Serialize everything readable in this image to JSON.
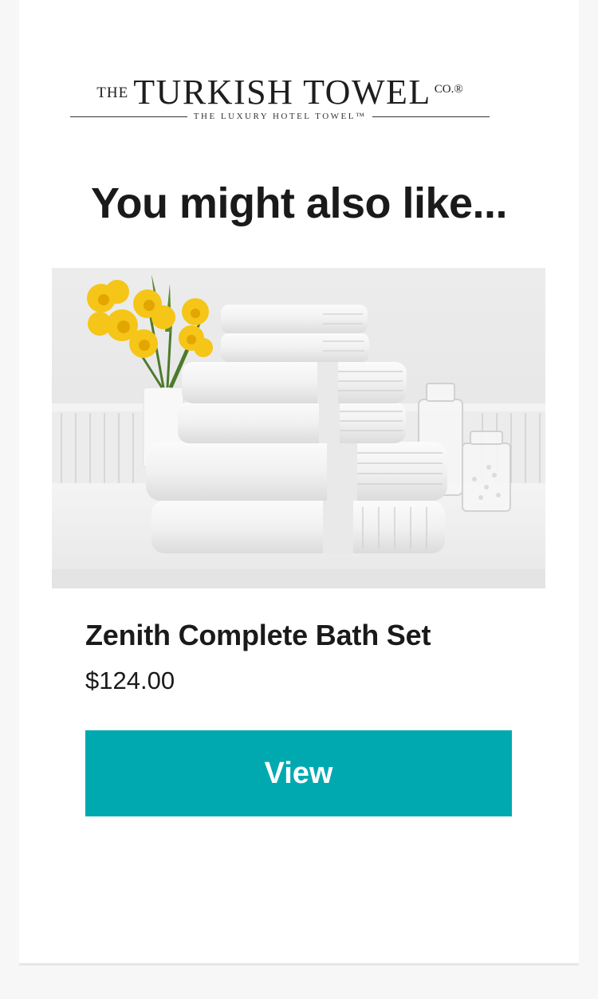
{
  "brand": {
    "prefix": "THE",
    "name": "TURKISH TOWEL",
    "suffix": "CO.®",
    "tagline": "THE LUXURY HOTEL TOWEL™"
  },
  "section": {
    "heading": "You might also like..."
  },
  "product": {
    "image_alt": "Zenith Complete Bath Set",
    "image_icon": "towel-stack-photo",
    "name": "Zenith Complete Bath Set",
    "price": "$124.00",
    "button_label": "View"
  },
  "colors": {
    "button": "#00a9b0",
    "text": "#1a1a1a",
    "page_background": "#f7f7f7",
    "card_background": "#ffffff"
  }
}
